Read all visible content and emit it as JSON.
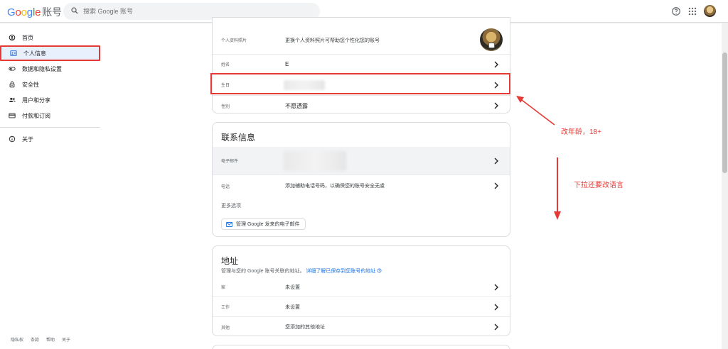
{
  "header": {
    "logo_text": "Google",
    "logo_account": "账号",
    "search_placeholder": "搜索 Google 账号"
  },
  "sidebar": {
    "items": [
      {
        "label": "首页",
        "icon": "home-icon"
      },
      {
        "label": "个人信息",
        "icon": "person-card-icon"
      },
      {
        "label": "数据和隐私设置",
        "icon": "toggle-icon"
      },
      {
        "label": "安全性",
        "icon": "lock-icon"
      },
      {
        "label": "用户和分享",
        "icon": "people-icon"
      },
      {
        "label": "付款和订阅",
        "icon": "card-icon"
      }
    ],
    "about": "关于"
  },
  "footer": [
    "隐私权",
    "条款",
    "帮助",
    "关于"
  ],
  "basic_info": {
    "photo_label": "个人资料照片",
    "photo_desc": "更换个人资料照片可帮助您个性化您的账号",
    "name_label": "姓名",
    "name_value": "E",
    "birthday_label": "生日",
    "gender_label": "性别",
    "gender_value": "不愿透露"
  },
  "contact": {
    "title": "联系信息",
    "email_label": "电子邮件",
    "phone_label": "电话",
    "phone_value": "添加辅助电话号码，以确保您的账号安全无虞",
    "more_options": "更多选项",
    "manage_button": "管理 Google 发来的电子邮件"
  },
  "address": {
    "title": "地址",
    "desc": "管理与您的 Google 账号关联的地址。",
    "link": "详细了解已保存到您账号的地址",
    "rows": [
      {
        "label": "家",
        "value": "未设置"
      },
      {
        "label": "工作",
        "value": "未设置"
      },
      {
        "label": "其他",
        "value": "您添加的其他地址"
      }
    ]
  },
  "annotations": {
    "age": "改年龄，18+",
    "scroll": "下拉还要改语言"
  },
  "colors": {
    "accent_red": "#e53935",
    "active_bg": "#e8f0fe",
    "link_blue": "#1a73e8"
  }
}
